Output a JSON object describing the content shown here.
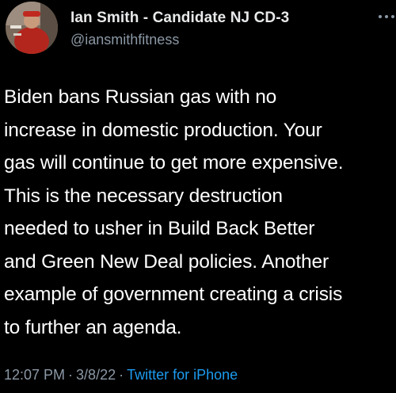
{
  "author": {
    "display_name": "Ian Smith - Candidate NJ CD-3",
    "handle": "@iansmithfitness"
  },
  "tweet": {
    "lines": [
      "Biden bans Russian gas with no",
      "increase in domestic production. Your",
      "gas will continue to get more expensive.",
      "This is the necessary destruction",
      "needed to usher in Build Back Better",
      "and Green New Deal policies. Another",
      "example of government creating a crisis",
      "to further an agenda."
    ]
  },
  "meta": {
    "time": "12:07 PM",
    "date": "3/8/22",
    "separator": "·",
    "source": "Twitter for iPhone"
  },
  "icons": {
    "more": "more-horizontal-icon",
    "avatar": "profile-photo"
  },
  "colors": {
    "background": "#000000",
    "text": "#ffffff",
    "secondary": "#8b98a5",
    "link": "#1d9bf0"
  }
}
